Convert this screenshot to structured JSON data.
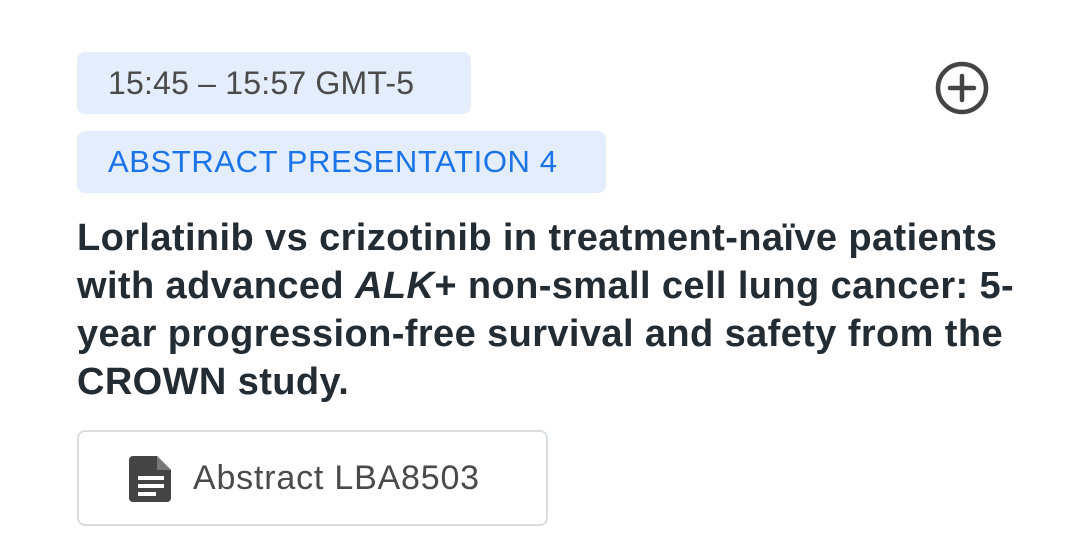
{
  "session": {
    "time": "15:45 – 15:57 GMT-5",
    "type": "ABSTRACT PRESENTATION 4",
    "title_before": "Lorlatinib vs crizotinib in treatment-naïve patients with advanced ",
    "title_italic": "ALK",
    "title_after": "+ non-small cell lung cancer: 5-year progression-free survival and safety from the CROWN study.",
    "abstract_label": "Abstract LBA8503"
  },
  "icons": {
    "add": "add-circle-icon",
    "abstract": "description-icon"
  },
  "colors": {
    "chip_background": "#e3edfb",
    "accent": "#1a73e8",
    "title_text": "#232b33",
    "icon": "#444444"
  }
}
